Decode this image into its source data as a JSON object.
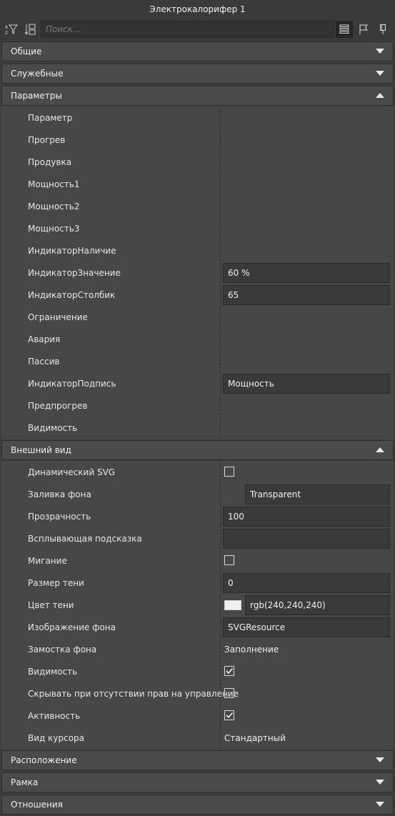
{
  "window": {
    "title": "Электрокалорифер 1"
  },
  "toolbar": {
    "search_placeholder": "Поиск...",
    "icons": [
      "filter-sort-icon",
      "sort-az-icon",
      "list-view-icon",
      "flag-icon",
      "pin-icon"
    ]
  },
  "sections": {
    "general": {
      "title": "Общие",
      "expanded": false
    },
    "service": {
      "title": "Служебные",
      "expanded": false
    },
    "parameters": {
      "title": "Параметры",
      "expanded": true,
      "rows": [
        {
          "label": "Параметр",
          "value": ""
        },
        {
          "label": "Прогрев",
          "value": ""
        },
        {
          "label": "Продувка",
          "value": ""
        },
        {
          "label": "Мощность1",
          "value": ""
        },
        {
          "label": "Мощность2",
          "value": ""
        },
        {
          "label": "Мощность3",
          "value": ""
        },
        {
          "label": "ИндикаторНаличие",
          "value": ""
        },
        {
          "label": "ИндикаторЗначение",
          "value": "60 %"
        },
        {
          "label": "ИндикаторСтолбик",
          "value": "65"
        },
        {
          "label": "Ограничение",
          "value": ""
        },
        {
          "label": "Авария",
          "value": ""
        },
        {
          "label": "Пассив",
          "value": ""
        },
        {
          "label": "ИндикаторПодпись",
          "value": "Мощность"
        },
        {
          "label": "Предпрогрев",
          "value": ""
        },
        {
          "label": "Видимость",
          "value": ""
        }
      ]
    },
    "appearance": {
      "title": "Внешний вид",
      "expanded": true,
      "rows": [
        {
          "label": "Динамический SVG",
          "checked": false
        },
        {
          "label": "Заливка фона",
          "value": "Transparent"
        },
        {
          "label": "Прозрачность",
          "value": "100"
        },
        {
          "label": "Всплывающая подсказка",
          "value": ""
        },
        {
          "label": "Мигание",
          "checked": false
        },
        {
          "label": "Размер тени",
          "value": "0"
        },
        {
          "label": "Цвет тени",
          "value": "rgb(240,240,240)",
          "color": "#f0f0f0"
        },
        {
          "label": "Изображение фона",
          "value": "SVGResource"
        },
        {
          "label": "Замостка фона",
          "value": "Заполнение"
        },
        {
          "label": "Видимость",
          "checked": true
        },
        {
          "label": "Скрывать при отсутствии прав на управление",
          "checked": false
        },
        {
          "label": "Активность",
          "checked": true
        },
        {
          "label": "Вид курсора",
          "value": "Стандартный"
        }
      ]
    },
    "location": {
      "title": "Расположение",
      "expanded": false
    },
    "frame": {
      "title": "Рамка",
      "expanded": false
    },
    "relations": {
      "title": "Отношения",
      "expanded": false
    }
  },
  "colors": {
    "background": "#3d3d3d",
    "header": "#4a4a4a",
    "field": "#3a3a3a",
    "text": "#e8e8e8"
  }
}
